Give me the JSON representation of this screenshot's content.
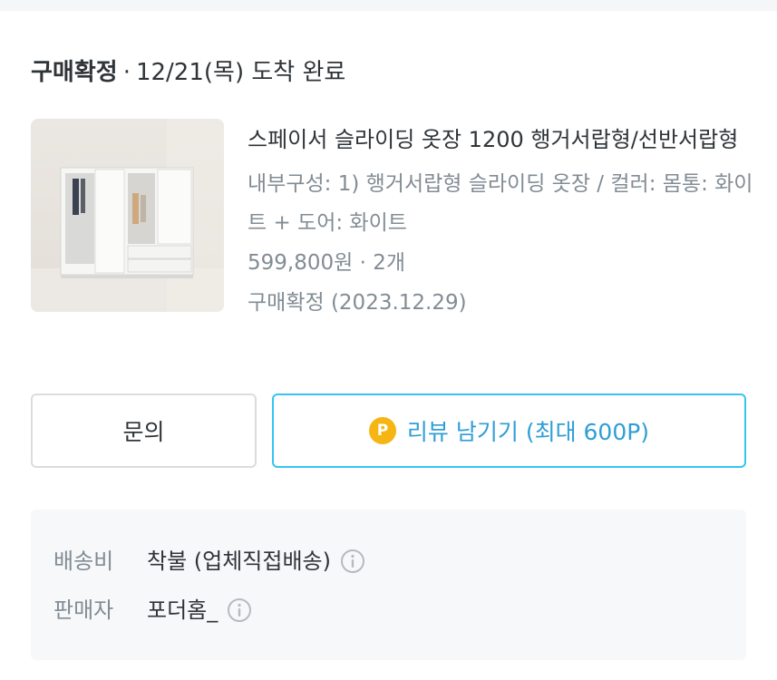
{
  "order": {
    "status": "구매확정",
    "separator": "·",
    "arrival": "12/21(목) 도착 완료"
  },
  "product": {
    "title": "스페이서 슬라이딩 옷장 1200 행거서랍형/선반서랍형",
    "options": "내부구성: 1) 행거서랍형 슬라이딩 옷장 / 컬러: 몸통: 화이트 + 도어: 화이트",
    "price_qty": "599,800원 · 2개",
    "confirmed": "구매확정 (2023.12.29)"
  },
  "actions": {
    "inquiry_label": "문의",
    "point_badge": "P",
    "review_label": "리뷰 남기기 (최대 600P)"
  },
  "seller_info": {
    "shipping_label": "배송비",
    "shipping_value": "착불 (업체직접배송)",
    "seller_label": "판매자",
    "seller_value": "포더홈_"
  },
  "colors": {
    "accent": "#35c5f0",
    "point": "#f5b513",
    "text_secondary": "#828c94"
  },
  "icons": {
    "info": "info-circle-icon",
    "point": "point-coin-icon"
  }
}
